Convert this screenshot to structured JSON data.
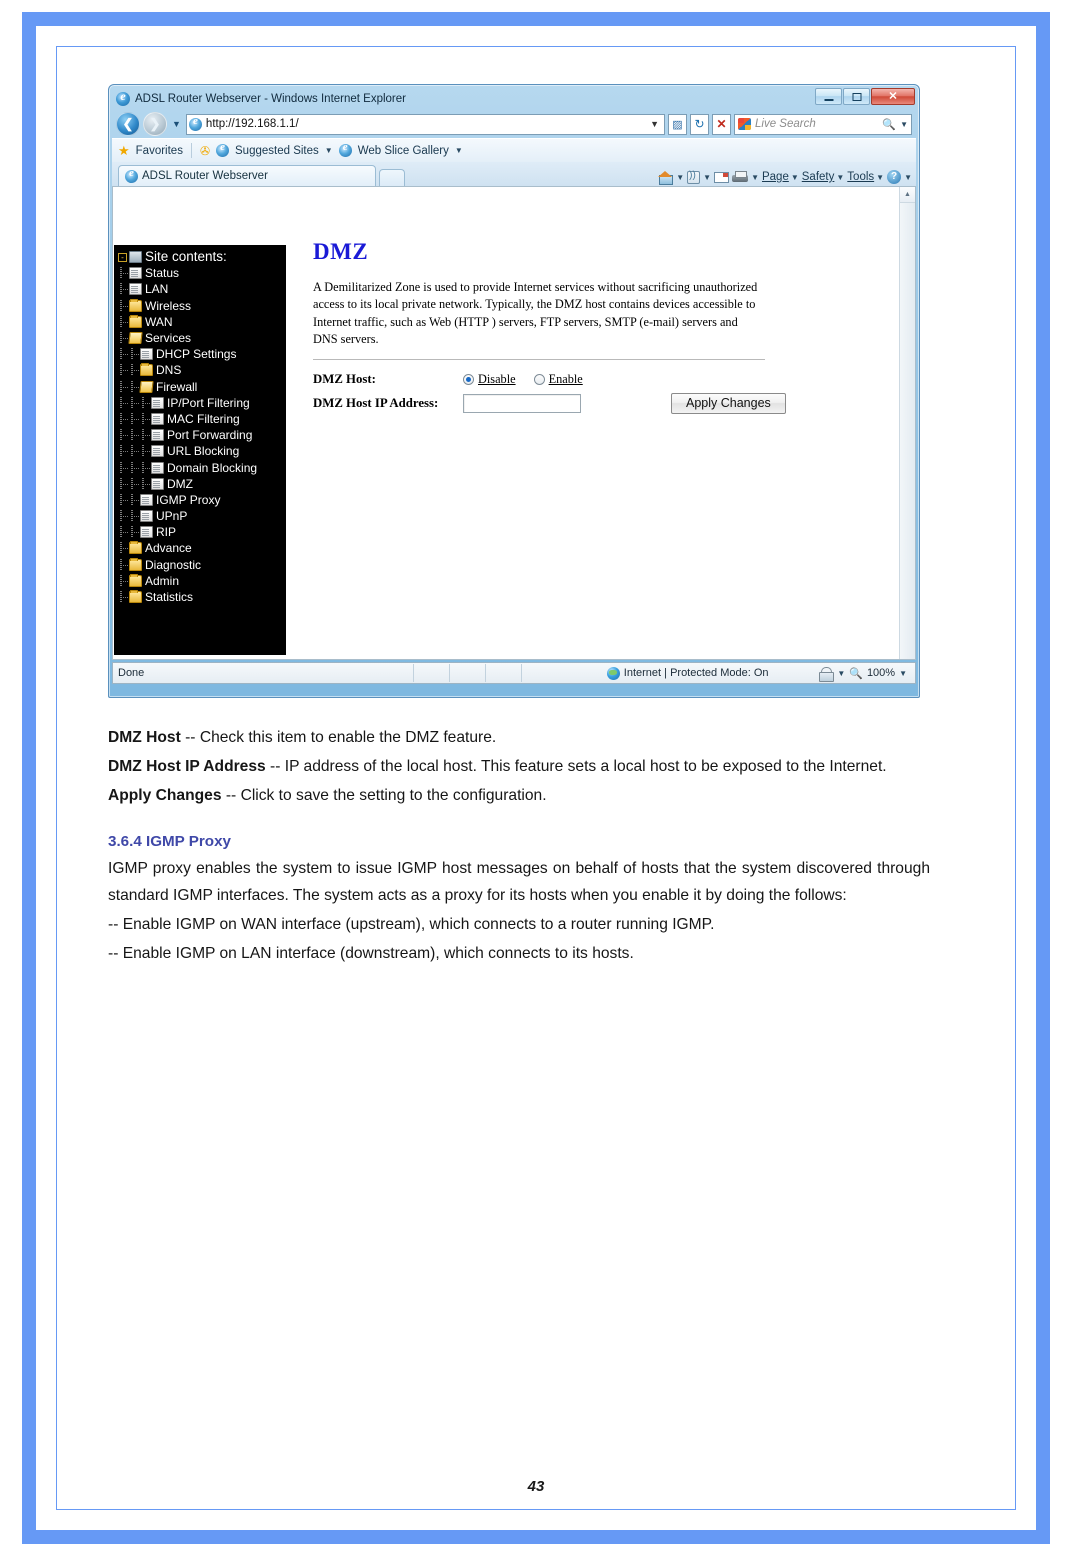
{
  "browser": {
    "window_title": "ADSL Router Webserver - Windows Internet Explorer",
    "window_controls": {
      "minimize": "–",
      "restore": "❐",
      "close": "✕"
    },
    "address": {
      "url": "http://192.168.1.1/",
      "dropdown_caret": "▼"
    },
    "nav": {
      "back": "◀",
      "forward": "▶",
      "recent_caret": "▼",
      "stop": "✕",
      "refresh": "↻",
      "compat": "▨"
    },
    "search": {
      "placeholder": "Live Search",
      "caret": "▼",
      "icon": "magnifier-icon"
    },
    "favorites_bar": {
      "favorites_label": "Favorites",
      "suggested_sites": "Suggested Sites",
      "web_slice_gallery": "Web Slice Gallery",
      "caret": "▼"
    },
    "tab": {
      "label": "ADSL Router Webserver"
    },
    "command_bar": [
      {
        "label": "",
        "icon": "home-icon",
        "caret": "▼"
      },
      {
        "label": "",
        "icon": "rss-feeds-icon",
        "caret": "▼"
      },
      {
        "label": "",
        "icon": "read-mail-icon",
        "caret": ""
      },
      {
        "label": "",
        "icon": "print-icon",
        "caret": "▼"
      },
      {
        "label": "Page",
        "icon": "",
        "caret": "▼"
      },
      {
        "label": "Safety",
        "icon": "",
        "caret": "▼"
      },
      {
        "label": "Tools",
        "icon": "",
        "caret": "▼"
      },
      {
        "label": "",
        "icon": "help-icon",
        "caret": "▼"
      }
    ],
    "status_bar": {
      "status_text": "Done",
      "zone_text": "Internet | Protected Mode: On",
      "zone_icon": "internet-globe-icon",
      "privacy_icon": "privacy-report-icon",
      "privacy_caret": "▼",
      "zoom_level": "100%",
      "zoom_icon": "zoom-magnifier-icon",
      "zoom_caret": "▼"
    }
  },
  "router_page": {
    "sitetree": {
      "root_label": "Site contents:",
      "root_icon": "site-icon",
      "expander": "-",
      "items": [
        {
          "label": "Status",
          "icon": "document-icon",
          "level": 1
        },
        {
          "label": "LAN",
          "icon": "document-icon",
          "level": 1
        },
        {
          "label": "Wireless",
          "icon": "folder-icon",
          "level": 1
        },
        {
          "label": "WAN",
          "icon": "folder-icon",
          "level": 1
        },
        {
          "label": "Services",
          "icon": "folder-open-icon",
          "level": 1
        },
        {
          "label": "DHCP Settings",
          "icon": "document-icon",
          "level": 2
        },
        {
          "label": "DNS",
          "icon": "folder-icon",
          "level": 2
        },
        {
          "label": "Firewall",
          "icon": "folder-open-icon",
          "level": 2
        },
        {
          "label": "IP/Port Filtering",
          "icon": "document-icon",
          "level": 3
        },
        {
          "label": "MAC Filtering",
          "icon": "document-icon",
          "level": 3
        },
        {
          "label": "Port Forwarding",
          "icon": "document-icon",
          "level": 3
        },
        {
          "label": "URL Blocking",
          "icon": "document-icon",
          "level": 3
        },
        {
          "label": "Domain Blocking",
          "icon": "document-icon",
          "level": 3
        },
        {
          "label": "DMZ",
          "icon": "document-icon",
          "level": 3
        },
        {
          "label": "IGMP Proxy",
          "icon": "document-icon",
          "level": 2
        },
        {
          "label": "UPnP",
          "icon": "document-icon",
          "level": 2
        },
        {
          "label": "RIP",
          "icon": "document-icon",
          "level": 2
        },
        {
          "label": "Advance",
          "icon": "folder-icon",
          "level": 1
        },
        {
          "label": "Diagnostic",
          "icon": "folder-icon",
          "level": 1
        },
        {
          "label": "Admin",
          "icon": "folder-icon",
          "level": 1
        },
        {
          "label": "Statistics",
          "icon": "folder-icon",
          "level": 1
        }
      ]
    },
    "content": {
      "title": "DMZ",
      "description": "A Demilitarized Zone is used to provide Internet services without sacrificing unauthorized access to its local private network. Typically, the DMZ host contains devices accessible to Internet traffic, such as Web (HTTP ) servers, FTP servers, SMTP (e-mail) servers and DNS servers.",
      "fields": {
        "dmz_host_label": "DMZ Host:",
        "radio_disable": "Disable",
        "radio_enable": "Enable",
        "selected": "Disable",
        "ip_label": "DMZ Host IP Address:",
        "ip_value": "",
        "apply_button": "Apply Changes"
      }
    }
  },
  "document": {
    "paragraphs": [
      {
        "bold": "DMZ Host",
        "text": " -- Check this item to enable the DMZ feature."
      },
      {
        "bold": "DMZ Host IP Address",
        "text": " -- IP address of the local host. This feature sets a local host to be exposed to the Internet."
      },
      {
        "bold": "Apply Changes",
        "text": " -- Click to save the setting to the configuration."
      }
    ],
    "section_heading": "3.6.4 IGMP Proxy",
    "section_body": "IGMP proxy enables the system to issue IGMP host messages on behalf of hosts that the system discovered through standard IGMP interfaces. The system acts as a proxy for its hosts when you enable it by doing the follows:",
    "bullets": [
      "-- Enable IGMP on WAN interface (upstream), which connects to a router running IGMP.",
      "-- Enable IGMP on LAN interface (downstream), which connects to its hosts."
    ],
    "page_number": "43"
  },
  "colors": {
    "page_border": "#6699f5",
    "heading_blue": "#3f48a8",
    "dmz_title_blue": "#1a1ad6",
    "tree_background": "#000000",
    "tree_text": "#ffffff"
  }
}
